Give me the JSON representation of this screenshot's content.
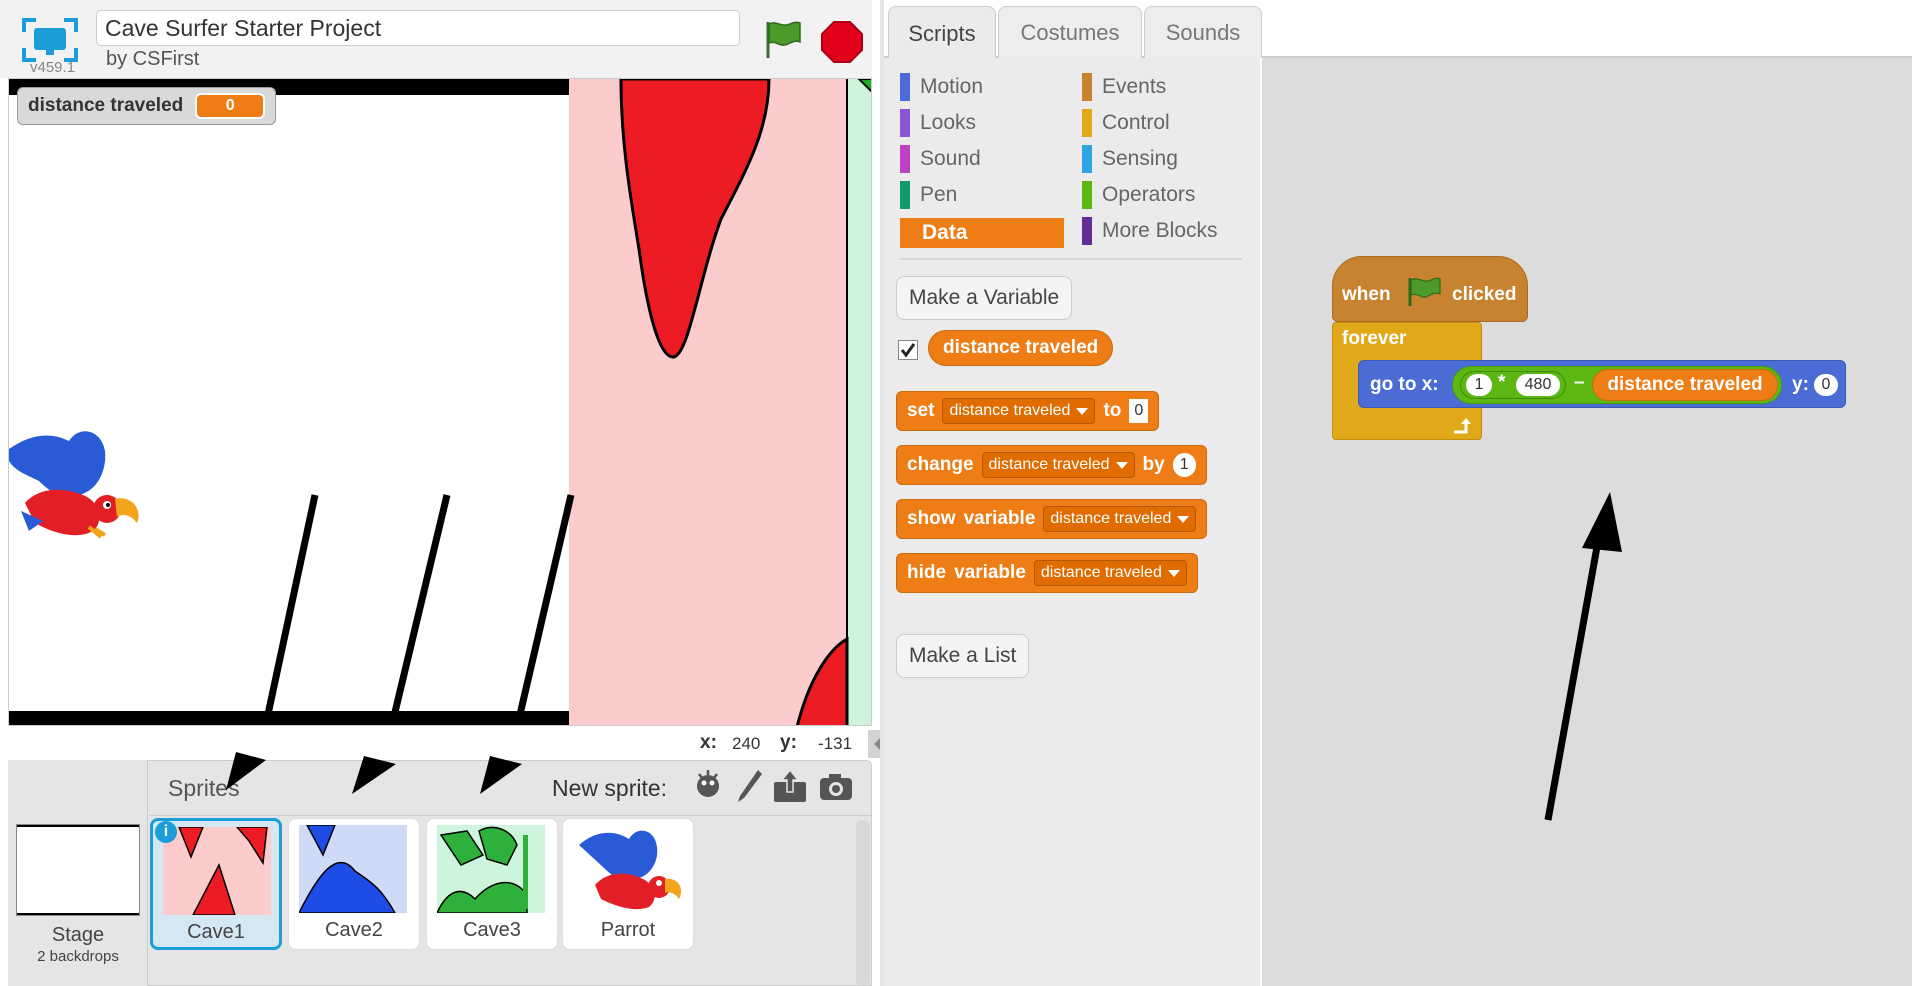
{
  "project": {
    "version": "v459.1",
    "title": "Cave Surfer Starter Project",
    "author": "by CSFirst"
  },
  "stage": {
    "monitor": {
      "label": "distance traveled",
      "value": "0"
    },
    "coords": {
      "x_label": "x:",
      "x_value": "240",
      "y_label": "y:",
      "y_value": "-131"
    }
  },
  "sprites_panel": {
    "title": "Sprites",
    "new_sprite_label": "New sprite:",
    "stage": {
      "label": "Stage",
      "backdrops": "2 backdrops"
    },
    "sprites": [
      {
        "name": "Cave1"
      },
      {
        "name": "Cave2"
      },
      {
        "name": "Cave3"
      },
      {
        "name": "Parrot"
      }
    ],
    "info_badge": "i"
  },
  "tabs": [
    {
      "label": "Scripts"
    },
    {
      "label": "Costumes"
    },
    {
      "label": "Sounds"
    }
  ],
  "categories": [
    {
      "label": "Motion",
      "color": "#4a6cd4"
    },
    {
      "label": "Looks",
      "color": "#8a55d7"
    },
    {
      "label": "Sound",
      "color": "#bb42c3"
    },
    {
      "label": "Pen",
      "color": "#0e9a6c"
    },
    {
      "label": "Data",
      "color": "#ee7d16"
    },
    {
      "label": "Events",
      "color": "#c88330"
    },
    {
      "label": "Control",
      "color": "#e1a91a"
    },
    {
      "label": "Sensing",
      "color": "#2ca5e2"
    },
    {
      "label": "Operators",
      "color": "#5cb712"
    },
    {
      "label": "More Blocks",
      "color": "#632d99"
    }
  ],
  "palette": {
    "make_variable": "Make a Variable",
    "variable_name": "distance traveled",
    "make_list": "Make a List",
    "set_block": {
      "word1": "set",
      "var": "distance traveled",
      "word2": "to",
      "value": "0"
    },
    "change_block": {
      "word1": "change",
      "var": "distance traveled",
      "word2": "by",
      "value": "1"
    },
    "show_block": {
      "word1": "show",
      "word2": "variable",
      "var": "distance traveled"
    },
    "hide_block": {
      "word1": "hide",
      "word2": "variable",
      "var": "distance traveled"
    }
  },
  "script": {
    "hat_when": "when",
    "hat_clicked": "clicked",
    "forever": "forever",
    "goto_label": "go to x:",
    "mult_left": "1",
    "mult_op": "*",
    "mult_right": "480",
    "minus_op": "–",
    "var_reporter": "distance traveled",
    "y_label": "y:",
    "y_value": "0"
  }
}
